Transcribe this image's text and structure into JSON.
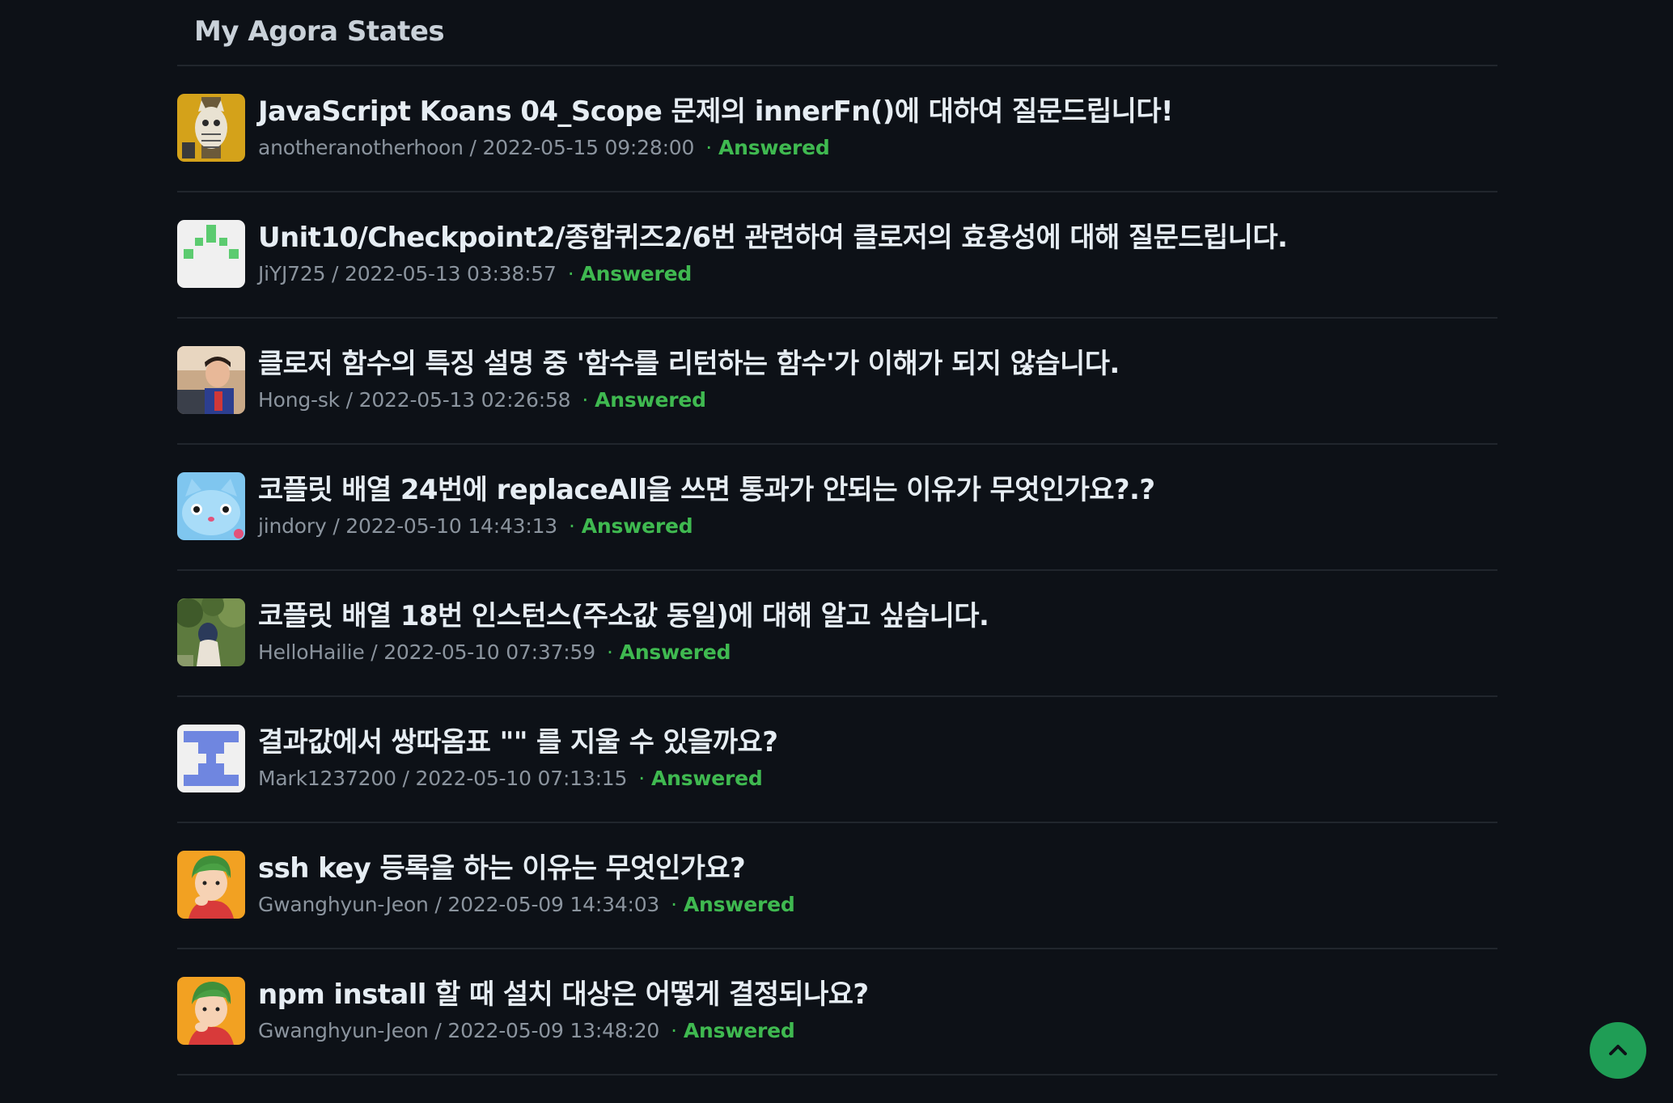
{
  "section": {
    "title": "My Agora States"
  },
  "discussions": [
    {
      "title": "JavaScript Koans 04_Scope 문제의 innerFn()에 대하여 질문드립니다!",
      "author_date": "anotheranotherhoon / 2022-05-15 09:28:00",
      "status": "Answered",
      "avatar": "cat-illustration-avatar"
    },
    {
      "title": "Unit10/Checkpoint2/종합퀴즈2/6번 관련하여 클로저의 효용성에 대해 질문드립니다.",
      "author_date": "JiYJ725 / 2022-05-13 03:38:57",
      "status": "Answered",
      "avatar": "green-identicon-avatar"
    },
    {
      "title": "클로저 함수의 특징 설명 중 '함수를 리턴하는 함수'가 이해가 되지 않습니다.",
      "author_date": "Hong-sk / 2022-05-13 02:26:58",
      "status": "Answered",
      "avatar": "person-photo-avatar"
    },
    {
      "title": "코플릿 배열 24번에 replaceAll을 쓰면 통과가 안되는 이유가 무엇인가요?.?",
      "author_date": "jindory / 2022-05-10 14:43:13",
      "status": "Answered",
      "avatar": "blue-cat-avatar"
    },
    {
      "title": "코플릿 배열 18번 인스턴스(주소값 동일)에 대해 알고 싶습니다.",
      "author_date": "HelloHailie / 2022-05-10 07:37:59",
      "status": "Answered",
      "avatar": "nature-photo-avatar"
    },
    {
      "title": "결과값에서 쌍따옴표 \"\" 를 지울 수 있을까요?",
      "author_date": "Mark1237200 / 2022-05-10 07:13:15",
      "status": "Answered",
      "avatar": "blue-identicon-avatar"
    },
    {
      "title": "ssh key 등록을 하는 이유는 무엇인가요?",
      "author_date": "Gwanghyun-Jeon / 2022-05-09 14:34:03",
      "status": "Answered",
      "avatar": "cartoon-person-avatar"
    },
    {
      "title": "npm install 할 때 설치 대상은 어떻게 결정되나요?",
      "author_date": "Gwanghyun-Jeon / 2022-05-09 13:48:20",
      "status": "Answered",
      "avatar": "cartoon-person-avatar"
    }
  ],
  "colors": {
    "background": "#0d1117",
    "answered": "#3fb950",
    "scroll_button": "#1f9d55"
  },
  "scroll_top": {
    "icon": "chevron-up-icon"
  }
}
